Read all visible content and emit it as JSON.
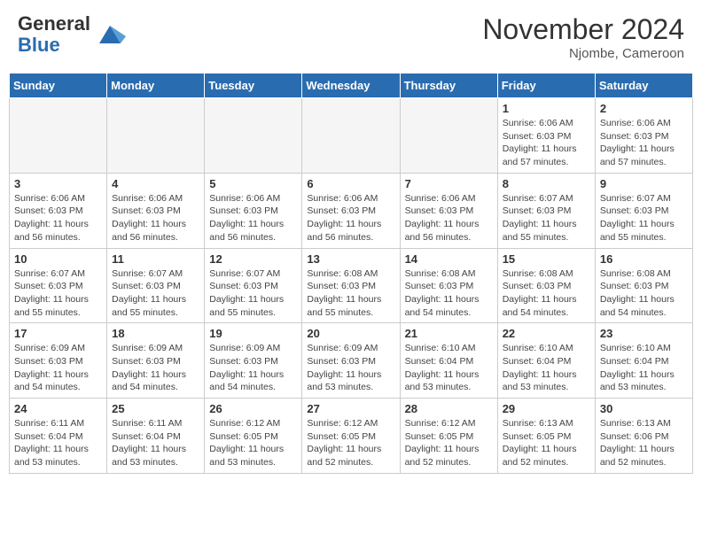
{
  "header": {
    "logo_general": "General",
    "logo_blue": "Blue",
    "month_title": "November 2024",
    "subtitle": "Njombe, Cameroon"
  },
  "weekdays": [
    "Sunday",
    "Monday",
    "Tuesday",
    "Wednesday",
    "Thursday",
    "Friday",
    "Saturday"
  ],
  "weeks": [
    [
      {
        "day": "",
        "empty": true
      },
      {
        "day": "",
        "empty": true
      },
      {
        "day": "",
        "empty": true
      },
      {
        "day": "",
        "empty": true
      },
      {
        "day": "",
        "empty": true
      },
      {
        "day": "1",
        "sunrise": "Sunrise: 6:06 AM",
        "sunset": "Sunset: 6:03 PM",
        "daylight": "Daylight: 11 hours and 57 minutes."
      },
      {
        "day": "2",
        "sunrise": "Sunrise: 6:06 AM",
        "sunset": "Sunset: 6:03 PM",
        "daylight": "Daylight: 11 hours and 57 minutes."
      }
    ],
    [
      {
        "day": "3",
        "sunrise": "Sunrise: 6:06 AM",
        "sunset": "Sunset: 6:03 PM",
        "daylight": "Daylight: 11 hours and 56 minutes."
      },
      {
        "day": "4",
        "sunrise": "Sunrise: 6:06 AM",
        "sunset": "Sunset: 6:03 PM",
        "daylight": "Daylight: 11 hours and 56 minutes."
      },
      {
        "day": "5",
        "sunrise": "Sunrise: 6:06 AM",
        "sunset": "Sunset: 6:03 PM",
        "daylight": "Daylight: 11 hours and 56 minutes."
      },
      {
        "day": "6",
        "sunrise": "Sunrise: 6:06 AM",
        "sunset": "Sunset: 6:03 PM",
        "daylight": "Daylight: 11 hours and 56 minutes."
      },
      {
        "day": "7",
        "sunrise": "Sunrise: 6:06 AM",
        "sunset": "Sunset: 6:03 PM",
        "daylight": "Daylight: 11 hours and 56 minutes."
      },
      {
        "day": "8",
        "sunrise": "Sunrise: 6:07 AM",
        "sunset": "Sunset: 6:03 PM",
        "daylight": "Daylight: 11 hours and 55 minutes."
      },
      {
        "day": "9",
        "sunrise": "Sunrise: 6:07 AM",
        "sunset": "Sunset: 6:03 PM",
        "daylight": "Daylight: 11 hours and 55 minutes."
      }
    ],
    [
      {
        "day": "10",
        "sunrise": "Sunrise: 6:07 AM",
        "sunset": "Sunset: 6:03 PM",
        "daylight": "Daylight: 11 hours and 55 minutes."
      },
      {
        "day": "11",
        "sunrise": "Sunrise: 6:07 AM",
        "sunset": "Sunset: 6:03 PM",
        "daylight": "Daylight: 11 hours and 55 minutes."
      },
      {
        "day": "12",
        "sunrise": "Sunrise: 6:07 AM",
        "sunset": "Sunset: 6:03 PM",
        "daylight": "Daylight: 11 hours and 55 minutes."
      },
      {
        "day": "13",
        "sunrise": "Sunrise: 6:08 AM",
        "sunset": "Sunset: 6:03 PM",
        "daylight": "Daylight: 11 hours and 55 minutes."
      },
      {
        "day": "14",
        "sunrise": "Sunrise: 6:08 AM",
        "sunset": "Sunset: 6:03 PM",
        "daylight": "Daylight: 11 hours and 54 minutes."
      },
      {
        "day": "15",
        "sunrise": "Sunrise: 6:08 AM",
        "sunset": "Sunset: 6:03 PM",
        "daylight": "Daylight: 11 hours and 54 minutes."
      },
      {
        "day": "16",
        "sunrise": "Sunrise: 6:08 AM",
        "sunset": "Sunset: 6:03 PM",
        "daylight": "Daylight: 11 hours and 54 minutes."
      }
    ],
    [
      {
        "day": "17",
        "sunrise": "Sunrise: 6:09 AM",
        "sunset": "Sunset: 6:03 PM",
        "daylight": "Daylight: 11 hours and 54 minutes."
      },
      {
        "day": "18",
        "sunrise": "Sunrise: 6:09 AM",
        "sunset": "Sunset: 6:03 PM",
        "daylight": "Daylight: 11 hours and 54 minutes."
      },
      {
        "day": "19",
        "sunrise": "Sunrise: 6:09 AM",
        "sunset": "Sunset: 6:03 PM",
        "daylight": "Daylight: 11 hours and 54 minutes."
      },
      {
        "day": "20",
        "sunrise": "Sunrise: 6:09 AM",
        "sunset": "Sunset: 6:03 PM",
        "daylight": "Daylight: 11 hours and 53 minutes."
      },
      {
        "day": "21",
        "sunrise": "Sunrise: 6:10 AM",
        "sunset": "Sunset: 6:04 PM",
        "daylight": "Daylight: 11 hours and 53 minutes."
      },
      {
        "day": "22",
        "sunrise": "Sunrise: 6:10 AM",
        "sunset": "Sunset: 6:04 PM",
        "daylight": "Daylight: 11 hours and 53 minutes."
      },
      {
        "day": "23",
        "sunrise": "Sunrise: 6:10 AM",
        "sunset": "Sunset: 6:04 PM",
        "daylight": "Daylight: 11 hours and 53 minutes."
      }
    ],
    [
      {
        "day": "24",
        "sunrise": "Sunrise: 6:11 AM",
        "sunset": "Sunset: 6:04 PM",
        "daylight": "Daylight: 11 hours and 53 minutes."
      },
      {
        "day": "25",
        "sunrise": "Sunrise: 6:11 AM",
        "sunset": "Sunset: 6:04 PM",
        "daylight": "Daylight: 11 hours and 53 minutes."
      },
      {
        "day": "26",
        "sunrise": "Sunrise: 6:12 AM",
        "sunset": "Sunset: 6:05 PM",
        "daylight": "Daylight: 11 hours and 53 minutes."
      },
      {
        "day": "27",
        "sunrise": "Sunrise: 6:12 AM",
        "sunset": "Sunset: 6:05 PM",
        "daylight": "Daylight: 11 hours and 52 minutes."
      },
      {
        "day": "28",
        "sunrise": "Sunrise: 6:12 AM",
        "sunset": "Sunset: 6:05 PM",
        "daylight": "Daylight: 11 hours and 52 minutes."
      },
      {
        "day": "29",
        "sunrise": "Sunrise: 6:13 AM",
        "sunset": "Sunset: 6:05 PM",
        "daylight": "Daylight: 11 hours and 52 minutes."
      },
      {
        "day": "30",
        "sunrise": "Sunrise: 6:13 AM",
        "sunset": "Sunset: 6:06 PM",
        "daylight": "Daylight: 11 hours and 52 minutes."
      }
    ]
  ]
}
